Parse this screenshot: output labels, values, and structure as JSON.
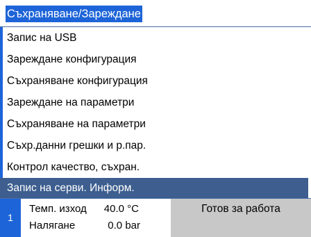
{
  "title": "Съхраняване/Зареждане",
  "menu": {
    "items": [
      {
        "label": "Запис на USB",
        "selected": false
      },
      {
        "label": "Зареждане конфигурация",
        "selected": false
      },
      {
        "label": "Съхраняване конфигурация",
        "selected": false
      },
      {
        "label": "Зареждане на параметри",
        "selected": false
      },
      {
        "label": "Съхраняване на параметри",
        "selected": false
      },
      {
        "label": "Съхр.данни грешки и р.пар.",
        "selected": false
      },
      {
        "label": "Контрол качество, съхран.",
        "selected": false
      },
      {
        "label": "Запис на серви. Информ.",
        "selected": true
      }
    ]
  },
  "status": {
    "index": "1",
    "rows": [
      {
        "label": "Темп. изход",
        "value": "40.0 °C"
      },
      {
        "label": "Налягане",
        "value": "0.0 bar"
      }
    ],
    "state": "Готов за работа"
  },
  "colors": {
    "accent_blue": "#1d64d8",
    "selected_row": "#3d5e8f",
    "status_panel": "#c8c8c8"
  }
}
